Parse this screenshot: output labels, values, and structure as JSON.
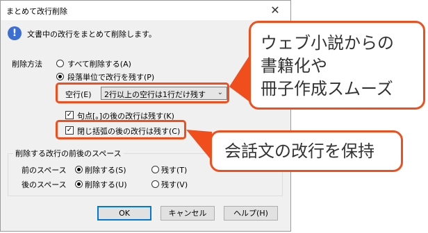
{
  "dialog": {
    "title": "まとめて改行削除",
    "close_glyph": "✕",
    "info_glyph": "!",
    "message": "文書中の改行をまとめて削除します。",
    "delete_method": {
      "label": "削除方法",
      "option_all": "すべて削除する(A)",
      "option_paragraph": "段落単位で改行を残す(P)"
    },
    "blank_line": {
      "label": "空行(E)",
      "selected": "2行以上の空行は1行だけ残す",
      "chevron": "⌄"
    },
    "keep_after_punct": {
      "label": "句点[。]の後の改行は残す(K)",
      "checked": true,
      "mark": "✓"
    },
    "keep_after_bracket": {
      "label": "閉じ括弧の後の改行は残す(C)",
      "checked": true,
      "mark": "✓"
    },
    "spacing_group": {
      "legend": "削除する改行の前後のスペース",
      "before": {
        "label": "前のスペース",
        "delete": "削除する(S)",
        "keep": "残す(T)"
      },
      "after": {
        "label": "後のスペース",
        "delete": "削除する(U)",
        "keep": "残す(V)"
      }
    },
    "buttons": {
      "ok": "OK",
      "cancel": "キャンセル",
      "help": "ヘルプ(H)"
    }
  },
  "callouts": {
    "top": {
      "line1": "ウェブ小説からの",
      "line2": "書籍化や",
      "line3": "冊子作成スムーズ"
    },
    "bottom": {
      "text": "会話文の改行を保持"
    }
  },
  "colors": {
    "accent": "#f04e1c",
    "info": "#3b6fd1",
    "default_button": "#0078d7"
  }
}
